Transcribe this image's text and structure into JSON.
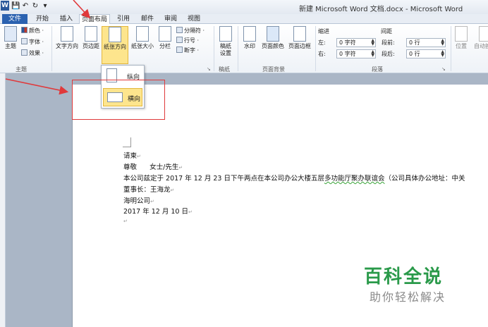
{
  "window": {
    "title": "新建 Microsoft Word 文档.docx - Microsoft Word",
    "app_icon": "W"
  },
  "quick_access": {
    "save_icon": "💾",
    "undo_icon": "↶",
    "redo_icon": "↻",
    "more_icon": "▾"
  },
  "tabs": [
    {
      "label": "文件"
    },
    {
      "label": "开始"
    },
    {
      "label": "插入"
    },
    {
      "label": "页面布局"
    },
    {
      "label": "引用"
    },
    {
      "label": "邮件"
    },
    {
      "label": "审阅"
    },
    {
      "label": "视图"
    }
  ],
  "ribbon": {
    "theme": {
      "label": "主题",
      "colors": "颜色 ·",
      "fonts": "字体 ·",
      "effects": "效果 ·",
      "group": "主题"
    },
    "page_setup": {
      "text_direction": "文字方向",
      "margins": "页边距",
      "orientation": "纸张方向",
      "size": "纸张大小",
      "columns": "分栏",
      "breaks": "分隔符 ·",
      "line_numbers": "行号 ·",
      "hyphenation": "断字 ·"
    },
    "draft": {
      "label": "稿纸\n设置",
      "group": "稿纸"
    },
    "page_background": {
      "watermark": "水印",
      "page_color": "页面颜色",
      "page_borders": "页面边框",
      "group": "页面背景"
    },
    "paragraph": {
      "indent_title": "缩进",
      "spacing_title": "间距",
      "left_label": "左:",
      "left_value": "0 字符",
      "right_label": "右:",
      "right_value": "0 字符",
      "before_label": "段前:",
      "before_value": "0 行",
      "after_label": "段后:",
      "after_value": "0 行",
      "group": "段落"
    },
    "arrange": {
      "position": "位置",
      "wrap": "自动换行"
    }
  },
  "orientation_menu": {
    "portrait": "纵向",
    "landscape": "横向"
  },
  "document": {
    "lines": [
      "请柬",
      "尊敬      女士/先生",
      "本公司兹定于 2017 年 12 月 23 日下午两点在本公司办公大楼五层",
      "多功能厅聚办联谊会",
      "（公司具体办公地址：中关",
      "董事长：王海龙",
      "海明公司",
      "2017 年 12 月 10 日"
    ],
    "paragraph_mark": "↵"
  },
  "watermark": {
    "title": "百科全说",
    "subtitle": "助你轻松解决"
  },
  "colors": {
    "accent": "#2b579a",
    "highlight": "#fde58d",
    "annotation": "#e0393b",
    "watermark": "#2a9a4a"
  }
}
